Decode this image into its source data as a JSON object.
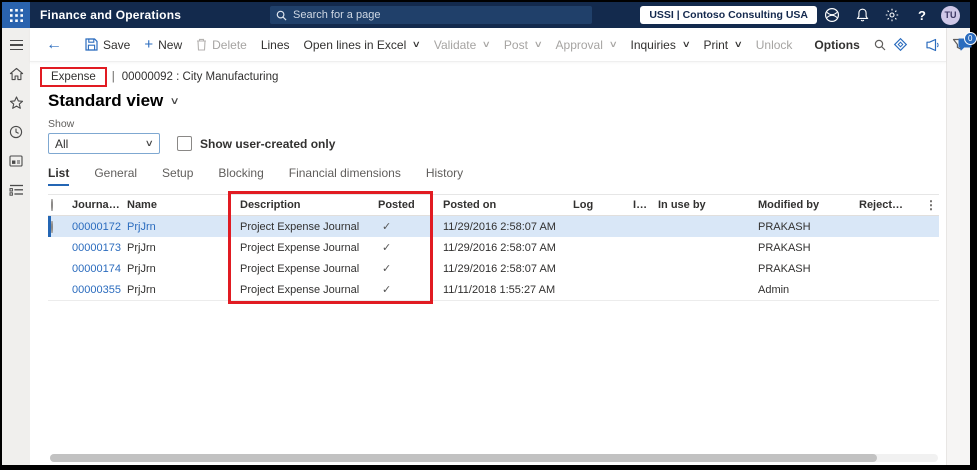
{
  "colors": {
    "topbar_navy": "#132a4d",
    "accent_blue": "#2b6cbe",
    "annotation_red": "#e11b22",
    "selected_row_bg": "#d9e7f7"
  },
  "icons": {
    "caret": "∨",
    "check": "✓",
    "sort_asc": "↑",
    "more_vertical": "⋮",
    "back_arrow": "←",
    "plus": "+",
    "help": "?"
  },
  "topbar": {
    "app_title": "Finance and Operations",
    "search_placeholder": "Search for a page",
    "company_badge": "USSI | Contoso Consulting USA",
    "avatar_initials": "TU"
  },
  "toolbar": {
    "save": "Save",
    "new": "New",
    "delete": "Delete",
    "lines": "Lines",
    "open_excel": "Open lines in Excel",
    "validate": "Validate",
    "post": "Post",
    "approval": "Approval",
    "inquiries": "Inquiries",
    "print": "Print",
    "unlock": "Unlock",
    "options": "Options",
    "messages_count": "0"
  },
  "breadcrumb": {
    "current": "Expense",
    "separator": "|",
    "record": "00000092 : City Manufacturing"
  },
  "view": {
    "title": "Standard view"
  },
  "filters": {
    "show_label": "Show",
    "show_value": "All",
    "user_created_label": "Show user-created only"
  },
  "tabs": [
    "List",
    "General",
    "Setup",
    "Blocking",
    "Financial dimensions",
    "History"
  ],
  "grid": {
    "columns": {
      "journal": "Journal ba...",
      "name": "Name",
      "description": "Description",
      "posted": "Posted",
      "posted_on": "Posted on",
      "log": "Log",
      "in_trunc": "In ...",
      "in_use_by": "In use by",
      "modified_by": "Modified by",
      "rejected_by": "Rejected by"
    },
    "rows": [
      {
        "journal": "00000172",
        "name": "PrjJrn",
        "description": "Project Expense Journal",
        "posted": "✓",
        "posted_on": "11/29/2016 2:58:07 AM",
        "modified_by": "PRAKASH"
      },
      {
        "journal": "00000173",
        "name": "PrjJrn",
        "description": "Project Expense Journal",
        "posted": "✓",
        "posted_on": "11/29/2016 2:58:07 AM",
        "modified_by": "PRAKASH"
      },
      {
        "journal": "00000174",
        "name": "PrjJrn",
        "description": "Project Expense Journal",
        "posted": "✓",
        "posted_on": "11/29/2016 2:58:07 AM",
        "modified_by": "PRAKASH"
      },
      {
        "journal": "00000355",
        "name": "PrjJrn",
        "description": "Project Expense Journal",
        "posted": "✓",
        "posted_on": "11/11/2018 1:55:27 AM",
        "modified_by": "Admin"
      }
    ]
  }
}
